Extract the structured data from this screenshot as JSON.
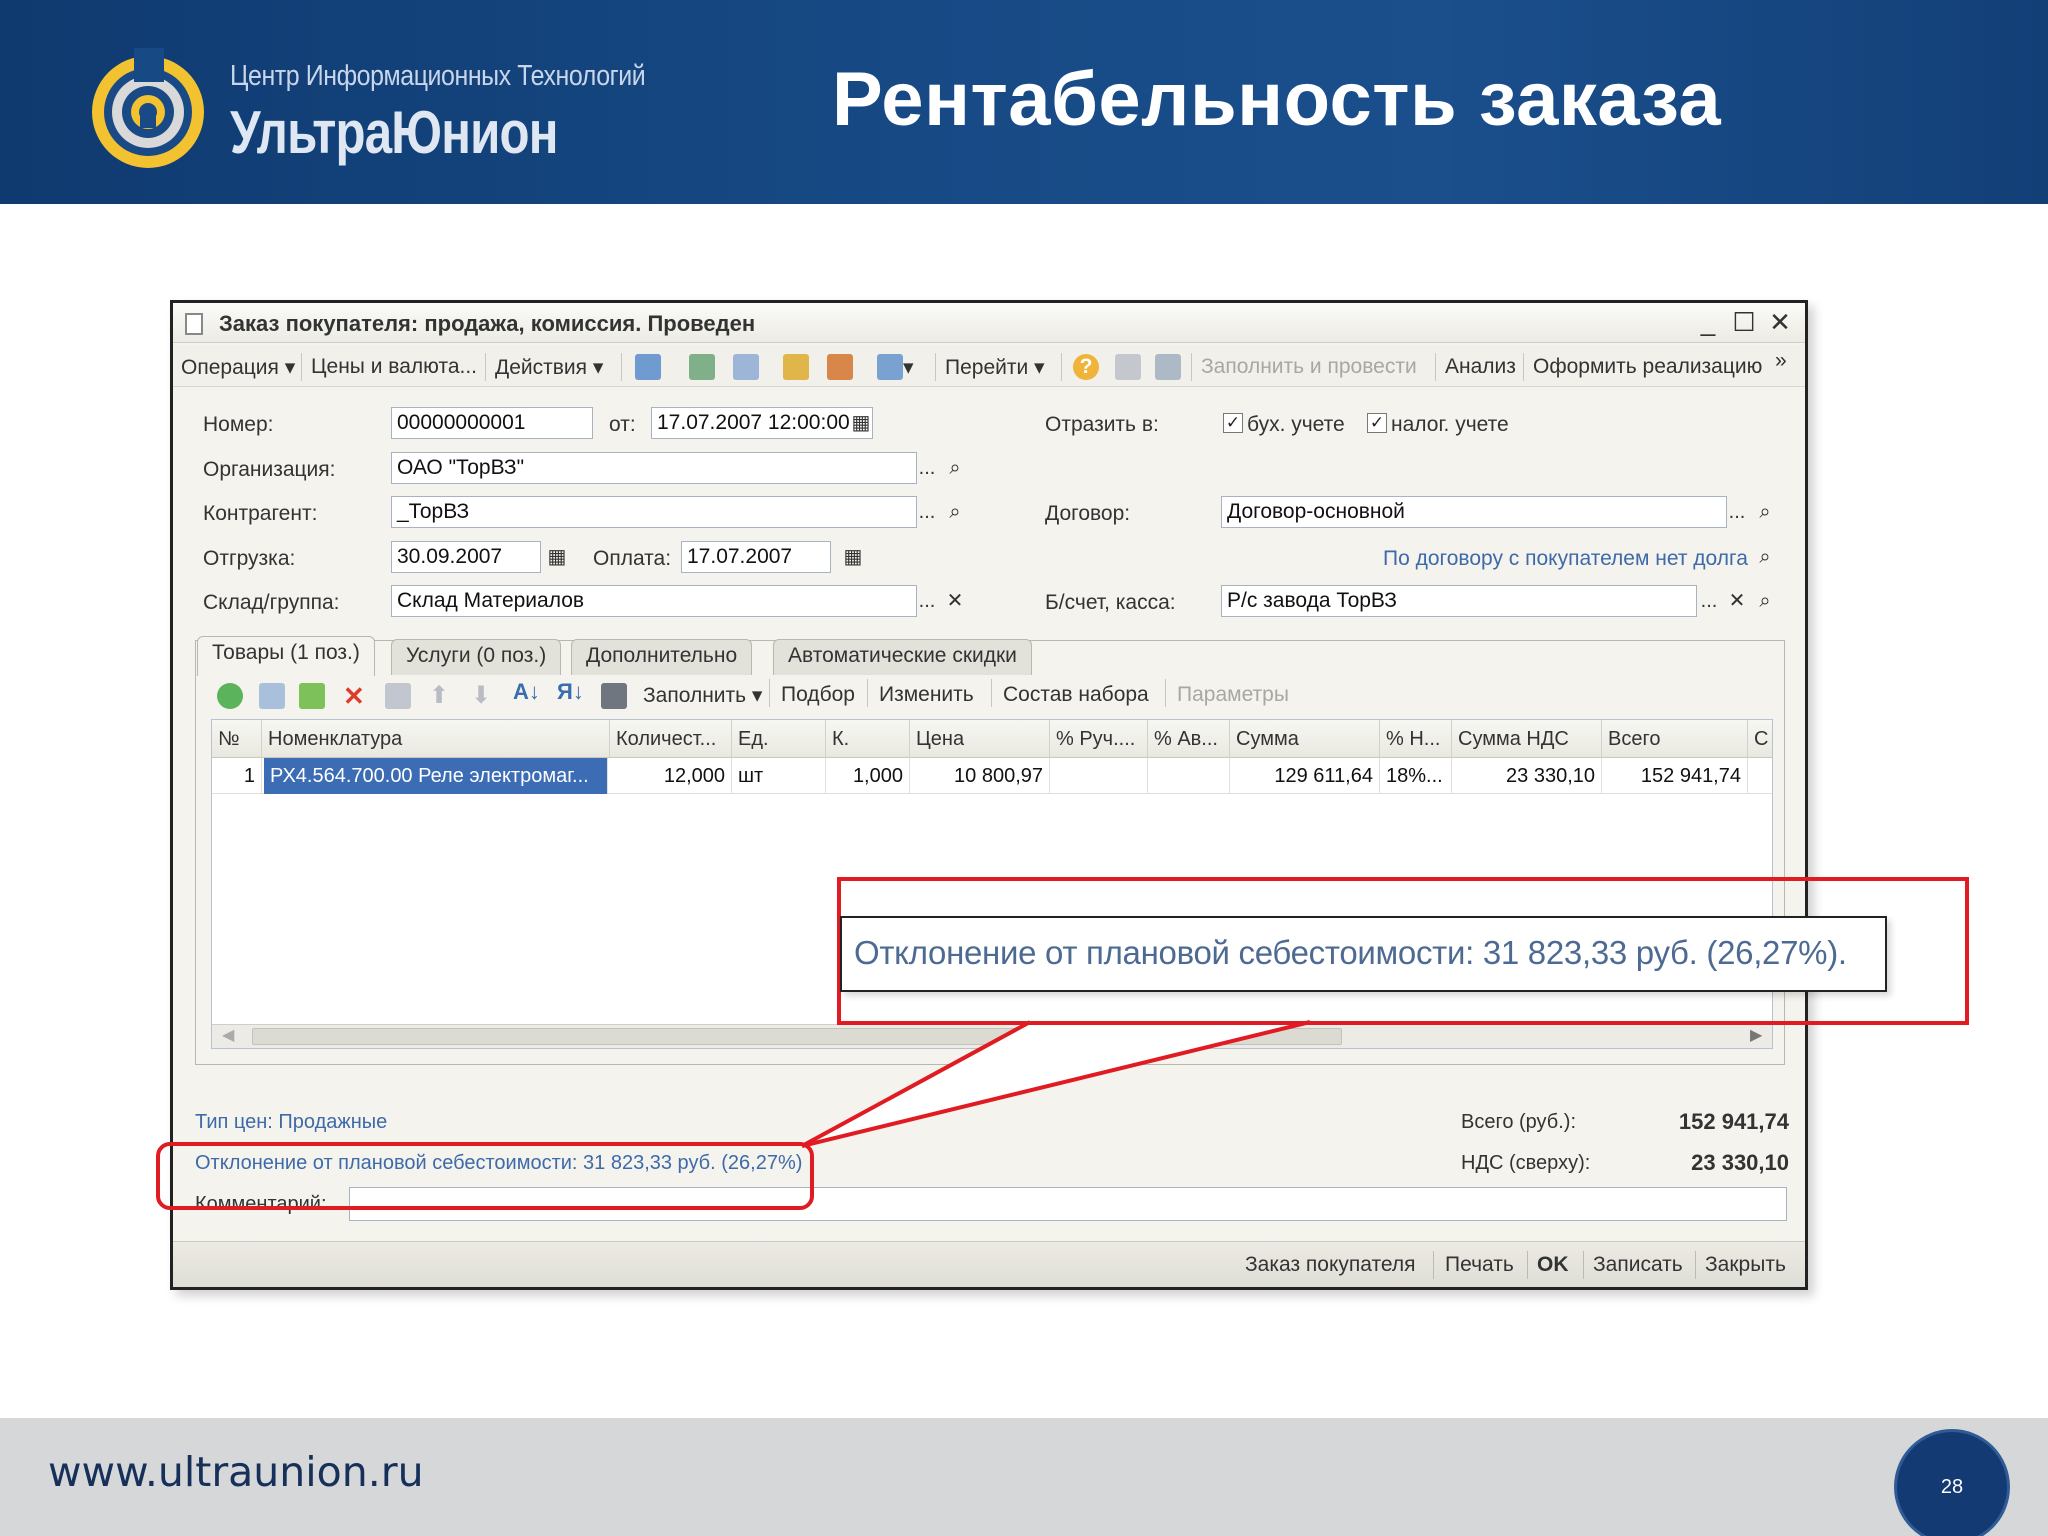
{
  "header": {
    "logo_line1": "Центр Информационных Технологий",
    "logo_line2": "УльтраЮнион",
    "title": "Рентабельность заказа"
  },
  "footer": {
    "url": "www.ultraunion.ru",
    "page_number": "28"
  },
  "window": {
    "title": "Заказ покупателя: продажа, комиссия. Проведен",
    "controls": {
      "minimize": "_",
      "maximize": "☐",
      "close": "✕"
    },
    "menu": {
      "operation": "Операция ▾",
      "prices": "Цены и валюта...",
      "actions": "Действия ▾",
      "goto": "Перейти ▾",
      "fill_post": "Заполнить и провести",
      "analysis": "Анализ",
      "create_sale": "Оформить реализацию",
      "more": "»"
    },
    "form": {
      "number_label": "Номер:",
      "number_value": "00000000001",
      "from_label": "от:",
      "date_value": "17.07.2007 12:00:00",
      "reflect_label": "Отразить в:",
      "acc_label": "бух. учете",
      "tax_label": "налог. учете",
      "org_label": "Организация:",
      "org_value": "ОАО \"ТорВЗ\"",
      "counterparty_label": "Контрагент:",
      "counterparty_value": "_ТорВЗ",
      "contract_label": "Договор:",
      "contract_value": "Договор-основной",
      "shipment_label": "Отгрузка:",
      "shipment_value": "30.09.2007",
      "payment_label": "Оплата:",
      "payment_value": "17.07.2007",
      "debt_link": "По договору с покупателем нет долга",
      "warehouse_label": "Склад/группа:",
      "warehouse_value": "Склад Материалов",
      "account_label": "Б/счет, касса:",
      "account_value": "Р/с завода ТорВЗ",
      "select_btn": "...",
      "check_mark": "✓",
      "clear_btn": "✕"
    },
    "tabs": [
      {
        "label": "Товары (1 поз.)"
      },
      {
        "label": "Услуги (0 поз.)"
      },
      {
        "label": "Дополнительно"
      },
      {
        "label": "Автоматические скидки"
      }
    ],
    "grid_toolbar": {
      "fill": "Заполнить ▾",
      "pick": "Подбор",
      "edit": "Изменить",
      "kit": "Состав набора",
      "params": "Параметры"
    },
    "grid": {
      "columns": [
        "№",
        "Номенклатура",
        "Количест...",
        "Ед.",
        "К.",
        "Цена",
        "% Руч....",
        "% Ав...",
        "Сумма",
        "% Н...",
        "Сумма НДС",
        "Всего",
        "С"
      ],
      "rows": [
        [
          "1",
          "РХ4.564.700.00 Реле электромаг...",
          "12,000",
          "шт",
          "1,000",
          "10 800,97",
          "",
          "",
          "129 611,64",
          "18%...",
          "23 330,10",
          "152 941,74",
          ""
        ]
      ]
    },
    "footer_info": {
      "price_type": "Тип цен: Продажные",
      "deviation": "Отклонение от плановой себестоимости: 31 823,33 руб. (26,27%)",
      "comment_label": "Комментарий:",
      "total_label": "Всего (руб.):",
      "total_value": "152 941,74",
      "vat_label": "НДС (сверху):",
      "vat_value": "23 330,10"
    },
    "statusbar": {
      "order": "Заказ покупателя",
      "print": "Печать",
      "ok": "OK",
      "save": "Записать",
      "close": "Закрыть"
    }
  },
  "callout": {
    "text": "Отклонение от плановой себестоимости: 31 823,33 руб. (26,27%)."
  },
  "colors": {
    "header_bg": "#174a85",
    "highlight": "#e01b22",
    "link": "#3e6aa8",
    "selection": "#3b6cb4"
  }
}
